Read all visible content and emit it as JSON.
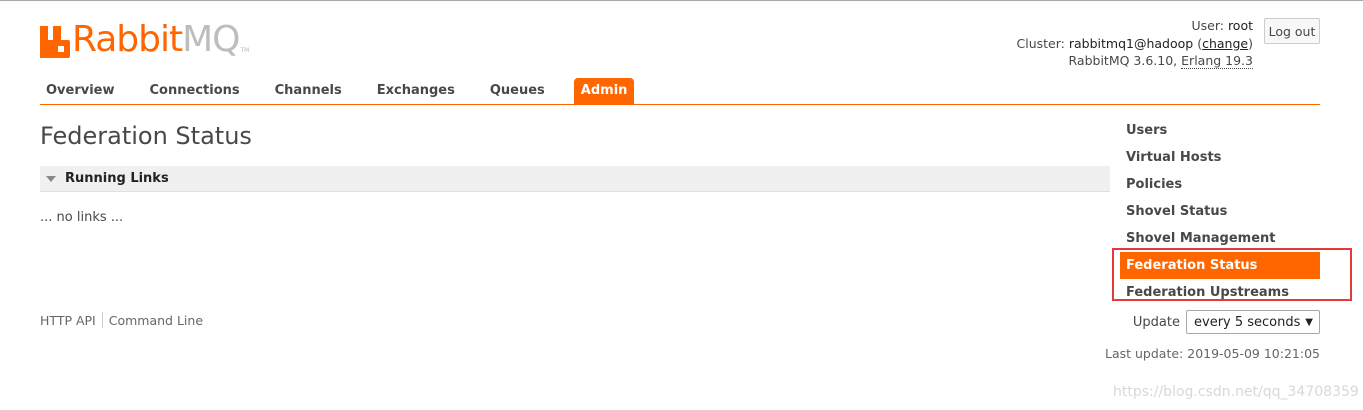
{
  "logo": {
    "word1": "Rabbit",
    "word2": "MQ",
    "tm": "TM"
  },
  "header": {
    "user_label": "User:",
    "user_value": "root",
    "cluster_label": "Cluster:",
    "cluster_value": "rabbitmq1@hadoop",
    "change_open": "(",
    "change_link": "change",
    "change_close": ")",
    "version": "RabbitMQ 3.6.10,",
    "erlang": "Erlang 19.3",
    "logout": "Log out"
  },
  "tabs": [
    {
      "label": "Overview"
    },
    {
      "label": "Connections"
    },
    {
      "label": "Channels"
    },
    {
      "label": "Exchanges"
    },
    {
      "label": "Queues"
    },
    {
      "label": "Admin",
      "active": true
    }
  ],
  "main": {
    "title": "Federation Status",
    "section_title": "Running Links",
    "empty_text": "... no links ..."
  },
  "footer": {
    "http_api": "HTTP API",
    "command_line": "Command Line"
  },
  "rightnav": {
    "items": [
      {
        "label": "Users"
      },
      {
        "label": "Virtual Hosts"
      },
      {
        "label": "Policies"
      },
      {
        "label": "Shovel Status"
      },
      {
        "label": "Shovel Management"
      },
      {
        "label": "Federation Status",
        "active": true
      },
      {
        "label": "Federation Upstreams"
      }
    ]
  },
  "update": {
    "label": "Update",
    "selected": "every 5 seconds",
    "last_update": "Last update: 2019-05-09 10:21:05"
  },
  "watermark": "https://blog.csdn.net/qq_34708359",
  "colors": {
    "accent": "#ff6600",
    "highlight": "#e03a3a"
  },
  "icons": {
    "collapse": "triangle-down-icon",
    "dropdown": "caret-down-icon"
  }
}
